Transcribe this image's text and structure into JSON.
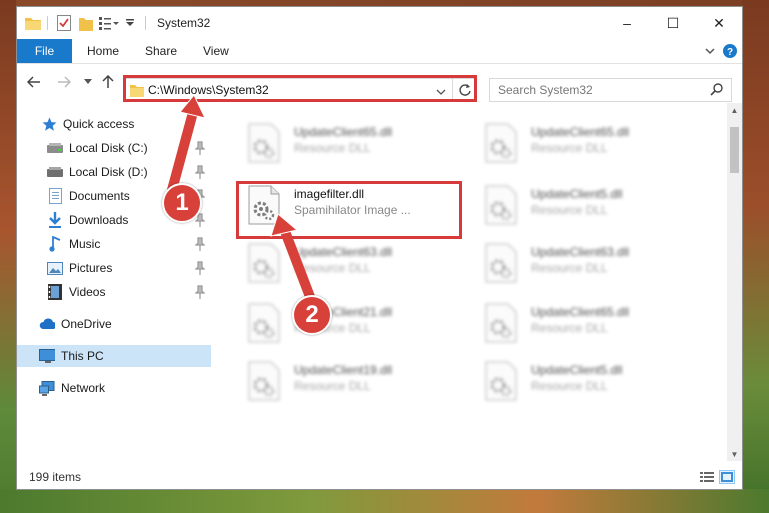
{
  "window": {
    "title": "System32",
    "controls": {
      "minimize": "–",
      "maximize": "☐",
      "close": "✕"
    }
  },
  "ribbon": {
    "tabs": [
      "File",
      "Home",
      "Share",
      "View"
    ]
  },
  "address": {
    "path": "C:\\Windows\\System32",
    "search_placeholder": "Search System32"
  },
  "sidebar": {
    "items": [
      {
        "label": "Quick access",
        "icon": "star-icon"
      },
      {
        "label": "Local Disk (C:)",
        "icon": "drive-icon",
        "pinned": true
      },
      {
        "label": "Local Disk (D:)",
        "icon": "drive-icon",
        "pinned": true
      },
      {
        "label": "Documents",
        "icon": "documents-icon",
        "pinned": true
      },
      {
        "label": "Downloads",
        "icon": "download-icon",
        "pinned": true
      },
      {
        "label": "Music",
        "icon": "music-icon",
        "pinned": true
      },
      {
        "label": "Pictures",
        "icon": "pictures-icon",
        "pinned": true
      },
      {
        "label": "Videos",
        "icon": "videos-icon",
        "pinned": true
      },
      {
        "label": "OneDrive",
        "icon": "cloud-icon"
      },
      {
        "label": "This PC",
        "icon": "computer-icon",
        "selected": true
      },
      {
        "label": "Network",
        "icon": "network-icon"
      }
    ]
  },
  "files": [
    {
      "name": "UpdateClient65.dll",
      "desc": "Resource DLL"
    },
    {
      "name": "UpdateClient65.dll",
      "desc": "Resource DLL"
    },
    {
      "name": "imagefilter.dll",
      "desc": "Spamihilator Image ..."
    },
    {
      "name": "UpdateClient5.dll",
      "desc": "Resource DLL"
    },
    {
      "name": "UpdateClient63.dll",
      "desc": "Resource DLL"
    },
    {
      "name": "UpdateClient63.dll",
      "desc": "Resource DLL"
    },
    {
      "name": "UpdateClient21.dll",
      "desc": "Resource DLL"
    },
    {
      "name": "UpdateClient65.dll",
      "desc": "Resource DLL"
    },
    {
      "name": "UpdateClient19.dll",
      "desc": "Resource DLL"
    },
    {
      "name": "UpdateClient5.dll",
      "desc": "Resource DLL"
    }
  ],
  "status": {
    "item_count": "199 items"
  },
  "callouts": [
    "1",
    "2"
  ],
  "colors": {
    "accent": "#1979ca",
    "highlight": "#d63a3a",
    "badge": "#d8403a",
    "selected": "#cce4f7"
  }
}
